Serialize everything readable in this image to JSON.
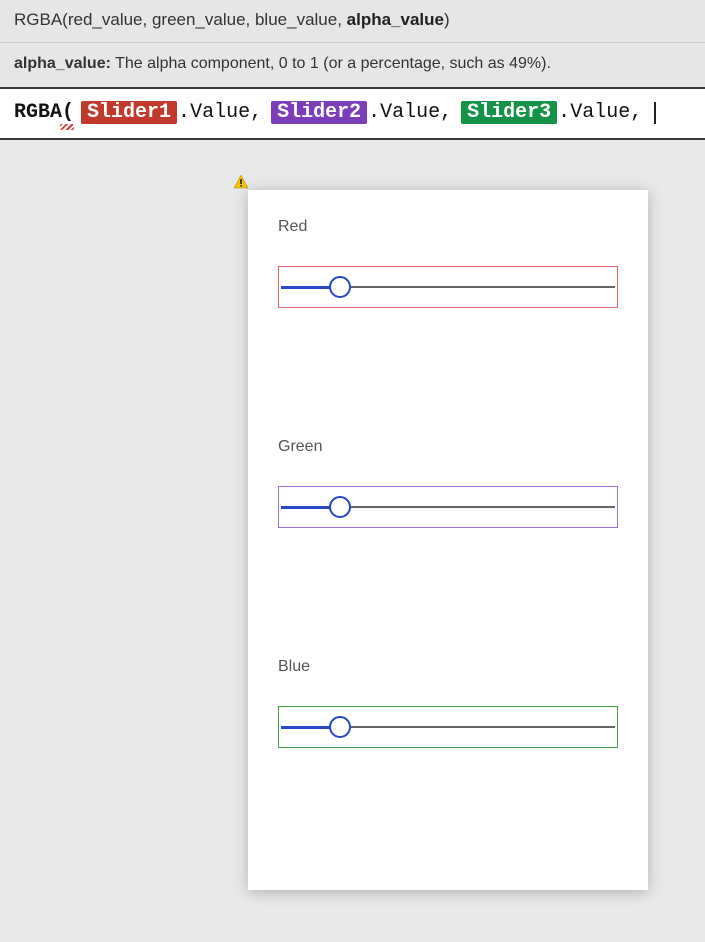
{
  "tooltip": {
    "signature_prefix": "RGBA(red_value, green_value, blue_value, ",
    "signature_bold": "alpha_value",
    "signature_suffix": ")",
    "param_name": "alpha_value:",
    "param_desc": " The alpha component, 0 to 1 (or a percentage, such as 49%)."
  },
  "formula": {
    "fn": "RGBA",
    "open_paren": "(",
    "tokens": [
      {
        "name": "Slider1",
        "member": "Value",
        "colorClass": "tok-red"
      },
      {
        "name": "Slider2",
        "member": "Value",
        "colorClass": "tok-purp"
      },
      {
        "name": "Slider3",
        "member": "Value",
        "colorClass": "tok-green"
      }
    ],
    "dot": ".",
    "comma": ","
  },
  "sliders": [
    {
      "label": "Red",
      "borderClass": "box-red",
      "percent": 18
    },
    {
      "label": "Green",
      "borderClass": "box-purp",
      "percent": 18
    },
    {
      "label": "Blue",
      "borderClass": "box-green",
      "percent": 18
    }
  ]
}
